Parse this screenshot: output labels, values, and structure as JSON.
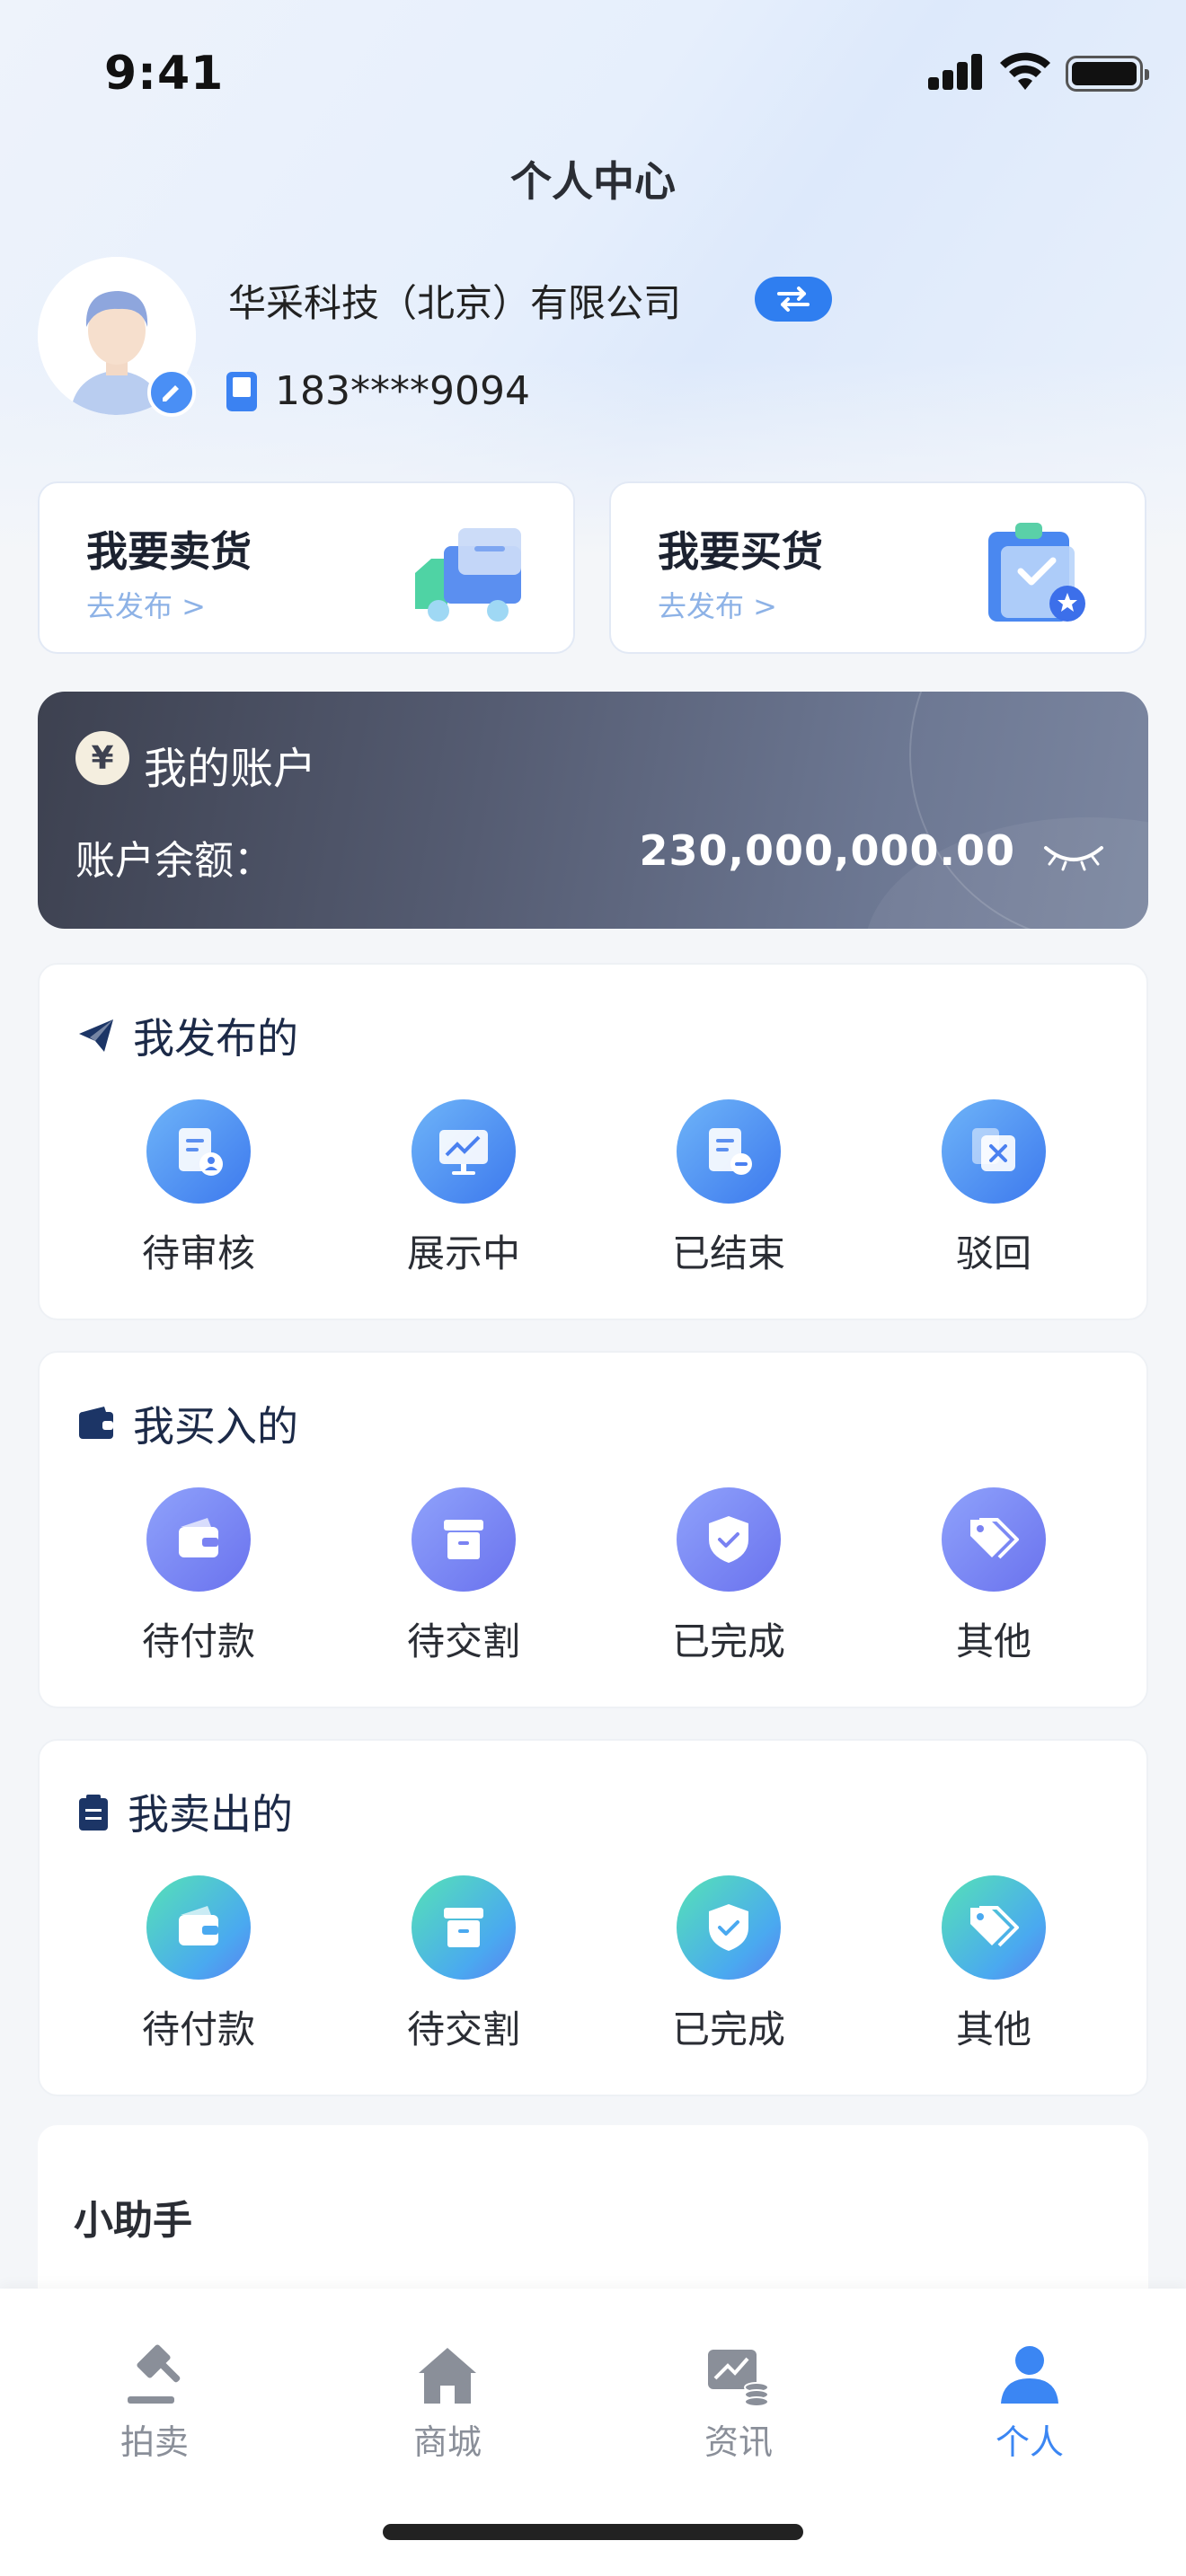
{
  "status_bar": {
    "time": "9:41"
  },
  "header": {
    "title": "个人中心"
  },
  "profile": {
    "company": "华采科技（北京）有限公司",
    "phone": "183****9094"
  },
  "actions": [
    {
      "title": "我要卖货",
      "sub": "去发布 >"
    },
    {
      "title": "我要买货",
      "sub": "去发布 >"
    }
  ],
  "account": {
    "icon": "yen-icon",
    "symbol": "¥",
    "title": "我的账户",
    "balance_label": "账户余额：",
    "balance": "230,000,000.00"
  },
  "published": {
    "title": "我发布的",
    "items": [
      "待审核",
      "展示中",
      "已结束",
      "驳回"
    ]
  },
  "bought": {
    "title": "我买入的",
    "items": [
      "待付款",
      "待交割",
      "已完成",
      "其他"
    ]
  },
  "sold": {
    "title": "我卖出的",
    "items": [
      "待付款",
      "待交割",
      "已完成",
      "其他"
    ]
  },
  "helper": {
    "title": "小助手"
  },
  "tabbar": {
    "items": [
      "拍卖",
      "商城",
      "资讯",
      "个人"
    ],
    "active": "个人"
  },
  "colors": {
    "accent": "#3b86f3",
    "account_bg": "#555c72",
    "teal": "#56e2b6",
    "purple": "#6a72ee"
  }
}
